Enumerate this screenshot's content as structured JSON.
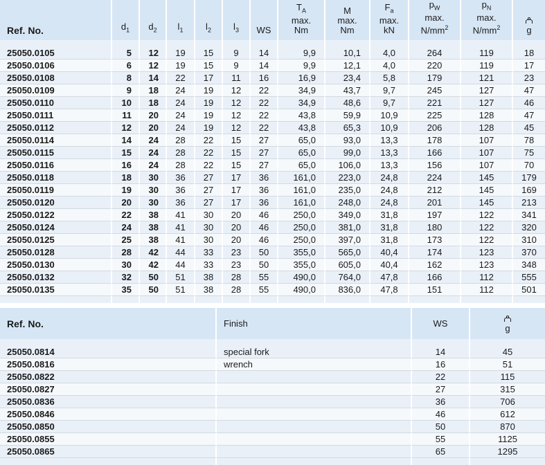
{
  "table1": {
    "headers": {
      "ref": "Ref. No.",
      "d1": "d",
      "d1_sub": "1",
      "d2": "d",
      "d2_sub": "2",
      "l1": "l",
      "l1_sub": "1",
      "l2": "l",
      "l2_sub": "2",
      "l3": "l",
      "l3_sub": "3",
      "ws": "WS",
      "ta_sym": "T",
      "ta_sub": "A",
      "ta_l2": "max.",
      "ta_l3": "Nm",
      "m_sym": "M",
      "m_l2": "max.",
      "m_l3": "Nm",
      "fa_sym": "F",
      "fa_sub": "a",
      "fa_l2": "max.",
      "fa_l3": "kN",
      "pw_sym": "p",
      "pw_sub": "W",
      "pw_l2": "max.",
      "pw_l3": "N/mm",
      "pw_sup": "2",
      "pn_sym": "p",
      "pn_sub": "N",
      "pn_l2": "max.",
      "pn_l3": "N/mm",
      "pn_sup": "2",
      "g": "g",
      "weight_icon": "weight-icon"
    },
    "rows": [
      [
        "25050.0105",
        "5",
        "12",
        "19",
        "15",
        "9",
        "14",
        "9,9",
        "10,1",
        "4,0",
        "264",
        "119",
        "18"
      ],
      [
        "25050.0106",
        "6",
        "12",
        "19",
        "15",
        "9",
        "14",
        "9,9",
        "12,1",
        "4,0",
        "220",
        "119",
        "17"
      ],
      [
        "25050.0108",
        "8",
        "14",
        "22",
        "17",
        "11",
        "16",
        "16,9",
        "23,4",
        "5,8",
        "179",
        "121",
        "23"
      ],
      [
        "25050.0109",
        "9",
        "18",
        "24",
        "19",
        "12",
        "22",
        "34,9",
        "43,7",
        "9,7",
        "245",
        "127",
        "47"
      ],
      [
        "25050.0110",
        "10",
        "18",
        "24",
        "19",
        "12",
        "22",
        "34,9",
        "48,6",
        "9,7",
        "221",
        "127",
        "46"
      ],
      [
        "25050.0111",
        "11",
        "20",
        "24",
        "19",
        "12",
        "22",
        "43,8",
        "59,9",
        "10,9",
        "225",
        "128",
        "47"
      ],
      [
        "25050.0112",
        "12",
        "20",
        "24",
        "19",
        "12",
        "22",
        "43,8",
        "65,3",
        "10,9",
        "206",
        "128",
        "45"
      ],
      [
        "25050.0114",
        "14",
        "24",
        "28",
        "22",
        "15",
        "27",
        "65,0",
        "93,0",
        "13,3",
        "178",
        "107",
        "78"
      ],
      [
        "25050.0115",
        "15",
        "24",
        "28",
        "22",
        "15",
        "27",
        "65,0",
        "99,0",
        "13,3",
        "166",
        "107",
        "75"
      ],
      [
        "25050.0116",
        "16",
        "24",
        "28",
        "22",
        "15",
        "27",
        "65,0",
        "106,0",
        "13,3",
        "156",
        "107",
        "70"
      ],
      [
        "25050.0118",
        "18",
        "30",
        "36",
        "27",
        "17",
        "36",
        "161,0",
        "223,0",
        "24,8",
        "224",
        "145",
        "179"
      ],
      [
        "25050.0119",
        "19",
        "30",
        "36",
        "27",
        "17",
        "36",
        "161,0",
        "235,0",
        "24,8",
        "212",
        "145",
        "169"
      ],
      [
        "25050.0120",
        "20",
        "30",
        "36",
        "27",
        "17",
        "36",
        "161,0",
        "248,0",
        "24,8",
        "201",
        "145",
        "213"
      ],
      [
        "25050.0122",
        "22",
        "38",
        "41",
        "30",
        "20",
        "46",
        "250,0",
        "349,0",
        "31,8",
        "197",
        "122",
        "341"
      ],
      [
        "25050.0124",
        "24",
        "38",
        "41",
        "30",
        "20",
        "46",
        "250,0",
        "381,0",
        "31,8",
        "180",
        "122",
        "320"
      ],
      [
        "25050.0125",
        "25",
        "38",
        "41",
        "30",
        "20",
        "46",
        "250,0",
        "397,0",
        "31,8",
        "173",
        "122",
        "310"
      ],
      [
        "25050.0128",
        "28",
        "42",
        "44",
        "33",
        "23",
        "50",
        "355,0",
        "565,0",
        "40,4",
        "174",
        "123",
        "370"
      ],
      [
        "25050.0130",
        "30",
        "42",
        "44",
        "33",
        "23",
        "50",
        "355,0",
        "605,0",
        "40,4",
        "162",
        "123",
        "348"
      ],
      [
        "25050.0132",
        "32",
        "50",
        "51",
        "38",
        "28",
        "55",
        "490,0",
        "764,0",
        "47,8",
        "166",
        "112",
        "555"
      ],
      [
        "25050.0135",
        "35",
        "50",
        "51",
        "38",
        "28",
        "55",
        "490,0",
        "836,0",
        "47,8",
        "151",
        "112",
        "501"
      ]
    ]
  },
  "table2": {
    "headers": {
      "ref": "Ref. No.",
      "finish": "Finish",
      "ws": "WS",
      "g": "g",
      "weight_icon": "weight-icon"
    },
    "rows": [
      [
        "25050.0814",
        "special fork",
        "14",
        "45"
      ],
      [
        "25050.0816",
        "wrench",
        "16",
        "51"
      ],
      [
        "25050.0822",
        "",
        "22",
        "115"
      ],
      [
        "25050.0827",
        "",
        "27",
        "315"
      ],
      [
        "25050.0836",
        "",
        "36",
        "706"
      ],
      [
        "25050.0846",
        "",
        "46",
        "612"
      ],
      [
        "25050.0850",
        "",
        "50",
        "870"
      ],
      [
        "25050.0855",
        "",
        "55",
        "1125"
      ],
      [
        "25050.0865",
        "",
        "65",
        "1295"
      ]
    ]
  }
}
